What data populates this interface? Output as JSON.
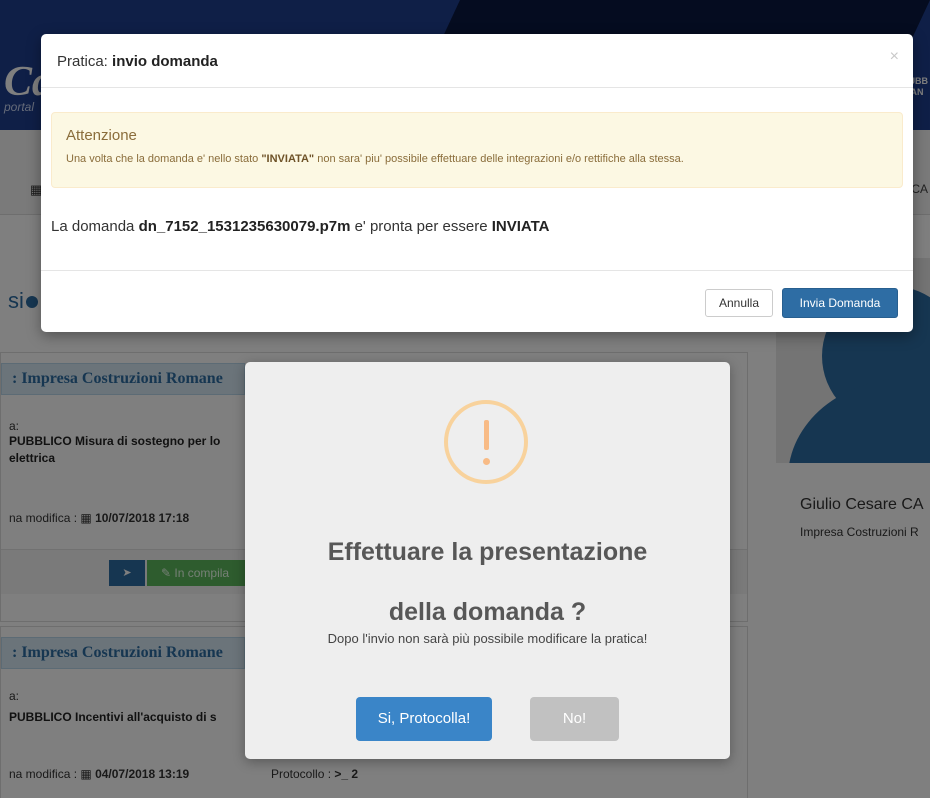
{
  "background": {
    "logo": "Ca",
    "logo_sub": "portal",
    "header_right": "PUBB\nLIAN",
    "nav_right": "CA",
    "list_title": "si",
    "cards": [
      {
        "company": ": Impresa Costruzioni Romane",
        "label": "a:",
        "title": "PUBBLICO Misura di sostegno per lo\nelettrica",
        "modified_label": "na modifica :",
        "modified": "10/07/2018 17:18",
        "status": "In compila"
      },
      {
        "company": ": Impresa Costruzioni Romane",
        "label": "a:",
        "title": "PUBBLICO Incentivi all'acquisto di s",
        "modified_label": "na modifica :",
        "modified": "04/07/2018 13:19",
        "protocol_label": "Protocollo :",
        "protocol": "2"
      }
    ],
    "profile": {
      "name": "Giulio Cesare CA",
      "company": "Impresa Costruzioni R"
    }
  },
  "modal": {
    "title_prefix": "Pratica:",
    "title": "invio domanda",
    "close": "×",
    "alert_title": "Attenzione",
    "alert_text_before": "Una volta che la domanda e' nello stato",
    "alert_status": "\"INVIATA\"",
    "alert_text_after": "non sara' piu' possibile effettuare delle integrazioni e/o rettifiche alla stessa.",
    "msg_before": "La domanda",
    "filename": "dn_7152_1531235630079.p7m",
    "msg_middle": "e' pronta per essere",
    "msg_status": "INVIATA",
    "cancel_label": "Annulla",
    "submit_label": "Invia Domanda"
  },
  "confirm": {
    "title_line1": "Effettuare la presentazione",
    "title_line2": "della domanda ?",
    "text": "Dopo l'invio non sarà più possibile modificare la pratica!",
    "confirm_label": "Si, Protocolla!",
    "cancel_label": "No!"
  },
  "colors": {
    "primary": "#2e6da4",
    "confirm": "#3a85c8",
    "warning_icon": "#f8bb86",
    "alert_bg": "#fcf8e3"
  }
}
